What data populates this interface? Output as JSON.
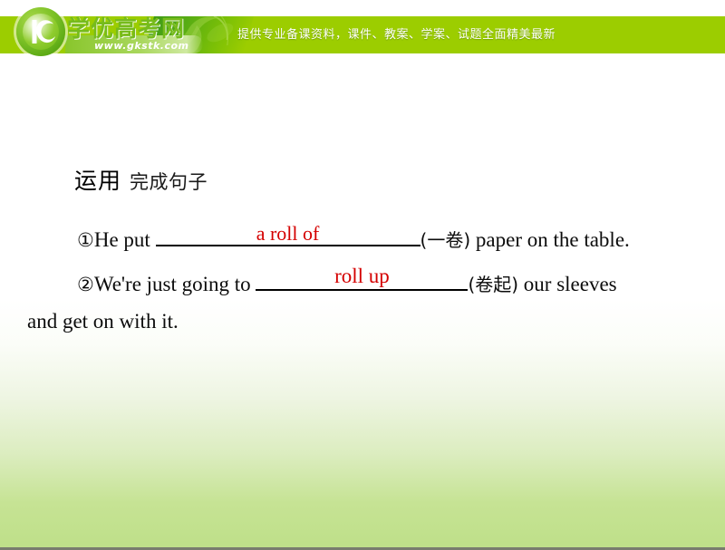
{
  "site": {
    "logo_text": "学优高考网",
    "logo_url": "www.gkstk.com",
    "banner_text": "提供专业备课资料，课件、教案、学案、试题全面精美最新",
    "banner_color": "#9ccd00",
    "logo_green": "#76bb1c"
  },
  "slide": {
    "heading_key": "运用",
    "heading_sub": "完成句子",
    "answer_color": "#d40000",
    "text_color": "#0c0c0c",
    "questions": [
      {
        "number": "①",
        "before": "He put ",
        "answer": "a roll of",
        "hint": "(一卷)",
        "after": " paper on the table."
      },
      {
        "number": "②",
        "before": "We're just going to ",
        "answer": "roll up",
        "hint": "(卷起)",
        "after": " our sleeves",
        "continuation": "and get on with it."
      }
    ]
  }
}
